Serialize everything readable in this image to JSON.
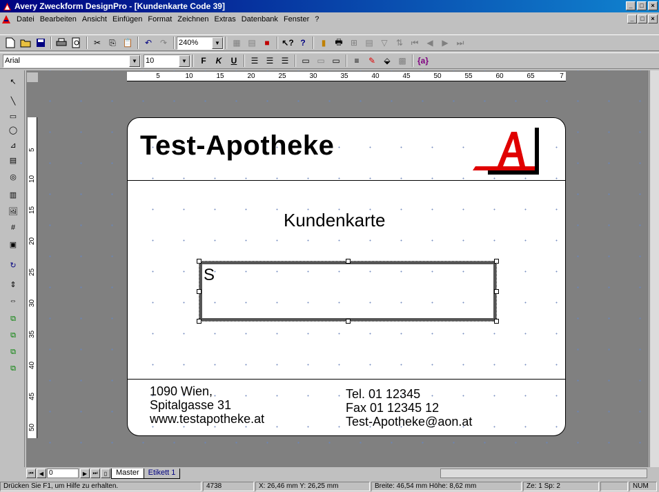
{
  "window": {
    "title": "Avery Zweckform DesignPro - [Kundenkarte Code 39]",
    "controls": [
      "_",
      "□",
      "×"
    ]
  },
  "menu": {
    "items": [
      "Datei",
      "Bearbeiten",
      "Ansicht",
      "Einfügen",
      "Format",
      "Zeichnen",
      "Extras",
      "Datenbank",
      "Fenster",
      "?"
    ]
  },
  "toolbar1": {
    "zoom_value": "240%"
  },
  "toolbar2": {
    "font_name": "Arial",
    "font_size": "10",
    "bold_label": "F",
    "italic_label": "K",
    "underline_label": "U",
    "field_label": "{a}"
  },
  "ruler": {
    "horizontal": [
      "5",
      "10",
      "15",
      "20",
      "25",
      "30",
      "35",
      "40",
      "45",
      "50",
      "55",
      "60",
      "65",
      "7"
    ],
    "vertical": [
      "5",
      "10",
      "15",
      "20",
      "25",
      "30",
      "35",
      "40",
      "45",
      "50"
    ]
  },
  "label": {
    "company": "Test-Apotheke",
    "title": "Kundenkarte",
    "barcode_text": "S",
    "address_left": [
      "1090 Wien,",
      "Spitalgasse 31",
      "www.testapotheke.at"
    ],
    "address_right": [
      "Tel. 01 12345",
      "Fax 01 12345 12",
      "Test-Apotheke@aon.at"
    ],
    "logo_color": "#e00000"
  },
  "tabs": {
    "page_number": "0",
    "sheets": [
      "Master",
      "Etikett 1"
    ]
  },
  "status": {
    "hint": "Drücken Sie F1, um Hilfe zu erhalten.",
    "object_id": "4738",
    "position": "X: 26,46 mm  Y: 26,25 mm",
    "size": "Breite: 46,54 mm  Höhe: 8,62 mm",
    "row_col": "Ze: 1  Sp: 2",
    "num": "NUM"
  }
}
